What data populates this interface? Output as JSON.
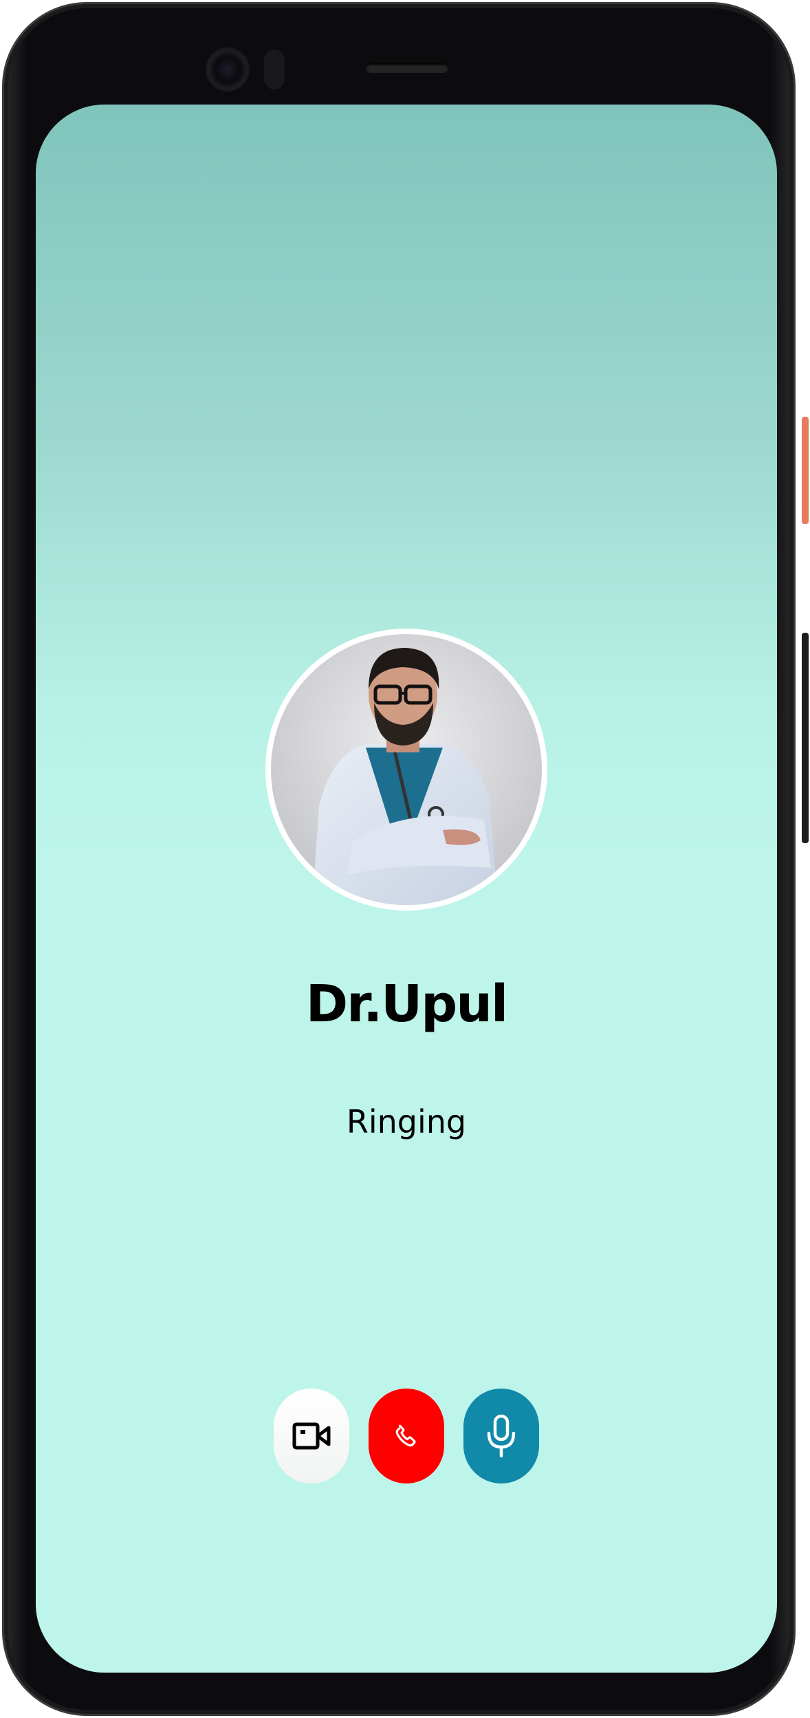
{
  "call": {
    "contact_name": "Dr.Upul",
    "status": "Ringing"
  },
  "controls": {
    "video": {
      "icon": "video-camera-icon"
    },
    "end_call": {
      "icon": "phone-icon",
      "color": "#ff0000"
    },
    "mute": {
      "icon": "microphone-icon",
      "color": "#1189a8"
    }
  },
  "theme": {
    "background_top": "#80c4bb",
    "background_bottom": "#bdf5ea",
    "text_color": "#000000"
  }
}
